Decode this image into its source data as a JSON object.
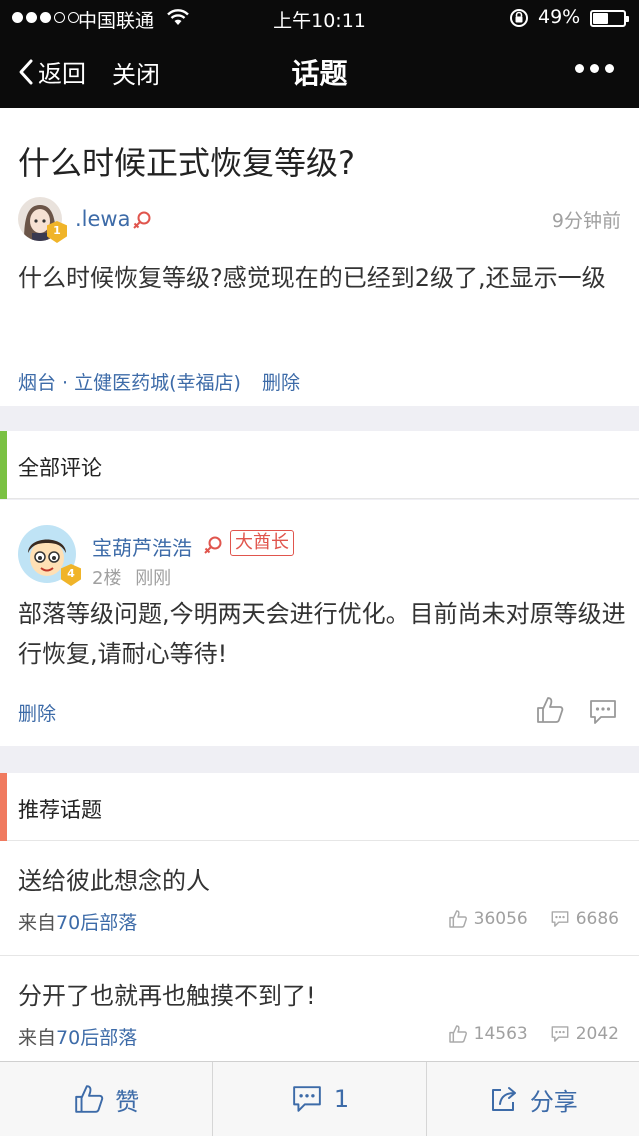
{
  "status_bar": {
    "carrier": "中国联通",
    "time": "上午10:11",
    "battery_percent": "49%",
    "battery_level": 0.49
  },
  "nav": {
    "back_label": "返回",
    "close_label": "关闭",
    "title": "话题"
  },
  "topic": {
    "title": "什么时候正式恢复等级?",
    "author": ".lewa",
    "author_level": "1",
    "time": "9分钟前",
    "body": "什么时候恢复等级?感觉现在的已经到2级了,还显示一级",
    "location": "烟台 · 立健医药城(幸福店)",
    "delete_label": "删除"
  },
  "comments_section": {
    "header": "全部评论",
    "accent_color": "#7ac143",
    "items": [
      {
        "author": "宝葫芦浩浩",
        "author_level": "4",
        "title_badge": "大酋长",
        "floor": "2楼",
        "time": "刚刚",
        "body": "部落等级问题,今明两天会进行优化。目前尚未对原等级进行恢复,请耐心等待!",
        "delete_label": "删除"
      }
    ]
  },
  "recommend_section": {
    "header": "推荐话题",
    "accent_color": "#f07a5f",
    "items": [
      {
        "title": "送给彼此想念的人",
        "from_prefix": "来自",
        "tribe": "70后部落",
        "likes": "36056",
        "comments": "6686"
      },
      {
        "title": "分开了也就再也触摸不到了!",
        "from_prefix": "来自",
        "tribe": "70后部落",
        "likes": "14563",
        "comments": "2042"
      }
    ]
  },
  "bottom_bar": {
    "like_label": "赞",
    "comment_count": "1",
    "share_label": "分享"
  }
}
